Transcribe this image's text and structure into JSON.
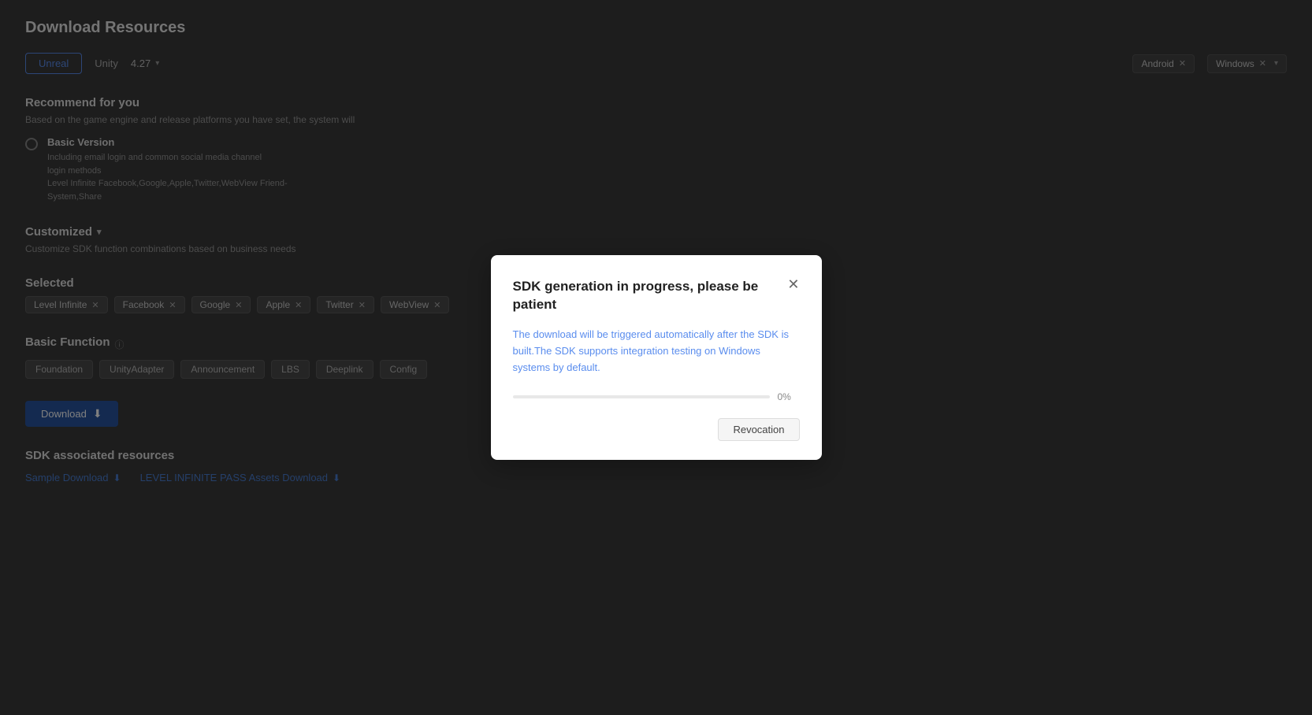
{
  "page": {
    "title": "Download Resources"
  },
  "tabs": {
    "unreal_label": "Unreal",
    "unity_label": "Unity",
    "version_value": "4.27",
    "android_label": "Android",
    "windows_label": "Windows"
  },
  "recommend_section": {
    "title": "Recommend for you",
    "subtitle": "Based on the game engine and release platforms you have set, the system will",
    "basic_version": {
      "title": "Basic Version",
      "desc_line1": "Including email login and common social media channel",
      "desc_line2": "login methods",
      "desc_line3": "Level Infinite Facebook,Google,Apple,Twitter,WebView Friend-",
      "desc_line4": "System,Share"
    }
  },
  "customized_section": {
    "title": "Customized",
    "subtitle": "Customize SDK function combinations based on business needs"
  },
  "selected_section": {
    "title": "Selected",
    "tags": [
      {
        "label": "Level Infinite"
      },
      {
        "label": "Facebook"
      },
      {
        "label": "Google"
      },
      {
        "label": "Apple"
      },
      {
        "label": "Twitter"
      },
      {
        "label": "WebView"
      }
    ]
  },
  "basic_function_section": {
    "title": "Basic Function",
    "tags": [
      {
        "label": "Foundation"
      },
      {
        "label": "UnityAdapter"
      },
      {
        "label": "Announcement"
      },
      {
        "label": "LBS"
      },
      {
        "label": "Deeplink"
      },
      {
        "label": "Config"
      }
    ]
  },
  "download_button": {
    "label": "Download"
  },
  "sdk_resources": {
    "title": "SDK associated resources",
    "sample_link": "Sample Download",
    "pass_link": "LEVEL INFINITE PASS Assets Download"
  },
  "modal": {
    "title": "SDK generation in progress, please be patient",
    "description": "The download will be triggered automatically after the SDK is built.The SDK supports integration testing on Windows systems by default.",
    "progress_value": 0,
    "progress_label": "0%",
    "revocation_label": "Revocation"
  }
}
